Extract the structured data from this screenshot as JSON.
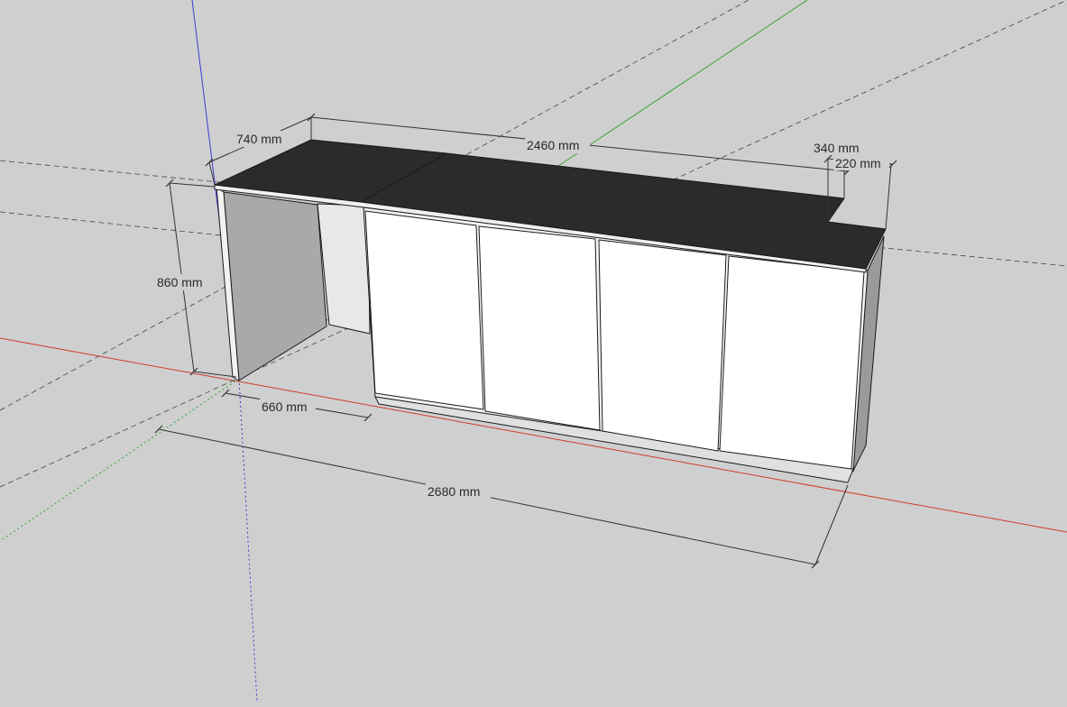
{
  "scene": {
    "background": "#cfcfcf",
    "axis_colors": {
      "x": "#d23a2a",
      "y": "#2fa52f",
      "z": "#3a3ad8"
    },
    "countertop_color": "#2b2b2b",
    "cabinet_color": "#ffffff"
  },
  "dimensions": {
    "counter_depth": "740 mm",
    "top_length": "2460 mm",
    "top_depth_right": "340 mm",
    "notch_depth": "220 mm",
    "height": "860 mm",
    "leg_opening": "660 mm",
    "overall_length": "2680 mm"
  }
}
